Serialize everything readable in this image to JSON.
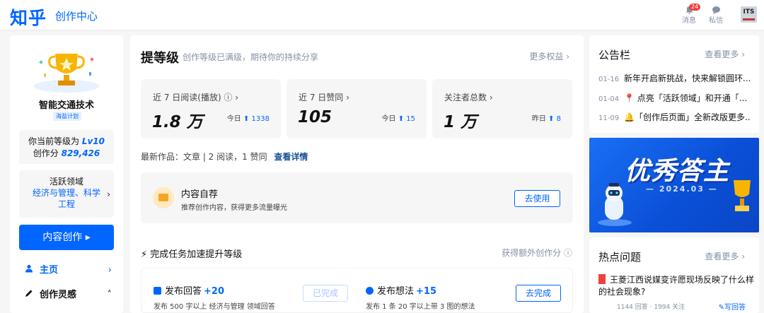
{
  "header": {
    "logo": "知乎",
    "section": "创作中心",
    "messages_label": "消息",
    "messages_badge": "24",
    "dm_label": "私信",
    "avatar_text": "ITS"
  },
  "profile": {
    "name": "智能交通技术",
    "plan_tag": "海盐计划",
    "level_prefix": "你当前等级为",
    "level": "Lv10",
    "score_prefix": "创作分",
    "score": "829,426",
    "active_title": "活跃领域",
    "active_fields": "经济与管理、科学工程"
  },
  "sidebar": {
    "create_button": "内容创作 ▸",
    "items": [
      {
        "label": "主页"
      },
      {
        "label": "创作灵感"
      }
    ]
  },
  "level_section": {
    "title": "提等级",
    "subtitle": "创作等级已满级，期待你的持续分享",
    "more": "更多权益 ›"
  },
  "stats": [
    {
      "label": "近 7 日阅读(播放) ⓘ ›",
      "value": "1.8 万",
      "delta_label": "今日",
      "delta": "1338"
    },
    {
      "label": "近 7 日赞同 ›",
      "value": "105",
      "delta_label": "今日",
      "delta": "15"
    },
    {
      "label": "关注者总数 ›",
      "value": "1 万",
      "delta_label": "昨日",
      "delta": "8"
    }
  ],
  "latest": {
    "text": "最新作品：文章 | 2 阅读，1 赞同",
    "link": "查看详情"
  },
  "recommend": {
    "title": "内容自荐",
    "desc": "推荐创作内容，获得更多流量曝光",
    "button": "去使用"
  },
  "tasks": {
    "title": "⚡ 完成任务加速提升等级",
    "extra": "获得额外创作分 ⓘ",
    "items": [
      {
        "name": "发布回答",
        "points": "+20",
        "desc": "发布 500 字以上 经济与管理 领域回答",
        "button": "已完成"
      },
      {
        "name": "发布想法",
        "points": "+15",
        "desc": "发布 1 条 20 字以上带 3 图的想法",
        "button": "去完成"
      }
    ]
  },
  "notice": {
    "title": "公告栏",
    "more": "查看更多 ›",
    "items": [
      {
        "date": "01-16",
        "text": "新年开启新挑战，快来解锁圆环..."
      },
      {
        "date": "01-04",
        "text": "📍 点亮「活跃领域」和开通「..."
      },
      {
        "date": "11-09",
        "text": "🔔「创作后页面」全新改版更多..."
      }
    ]
  },
  "banner": {
    "title": "优秀答主",
    "date": "— 2024.03 —"
  },
  "hot": {
    "title": "热点问题",
    "more": "查看更多 ›",
    "question": "王菱江西说媒变许愿现场反映了什么样的社会现象?",
    "meta": "1144 回答 · 1994 关注",
    "answer": "✎写回答"
  },
  "colors": {
    "brand": "#0066ff",
    "text_secondary": "#8590a6",
    "background": "#f6f6f6"
  }
}
